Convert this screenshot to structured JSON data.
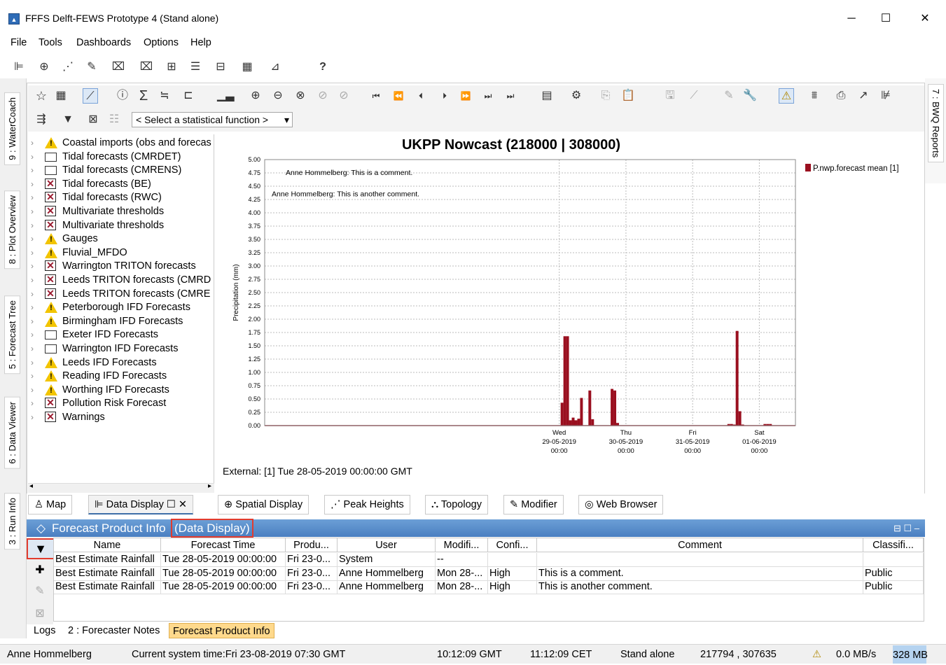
{
  "window": {
    "title": "FFFS Delft-FEWS Prototype 4  (Stand alone)",
    "minimize": "─",
    "maximize": "☐",
    "close": "✕"
  },
  "menu": [
    "File",
    "Tools",
    "Dashboards",
    "Options",
    "Help"
  ],
  "toolbar1": {
    "help": "?"
  },
  "side_tabs_left": [
    "9 : WaterCoach",
    "8 : Plot Overview",
    "5 : Forecast Tree",
    "6 : Data Viewer",
    "3 : Run Info"
  ],
  "side_tab_right": "7 : BWQ Reports",
  "stat_select": {
    "value": "< Select a statistical function >"
  },
  "tree": [
    {
      "label": "Coastal imports (obs and forecas",
      "icon": "warning-icon"
    },
    {
      "label": "Tidal forecasts (CMRDET)",
      "icon": "folder-icon"
    },
    {
      "label": "Tidal forecasts (CMRENS)",
      "icon": "folder-icon"
    },
    {
      "label": "Tidal forecasts (BE)",
      "icon": "error-icon"
    },
    {
      "label": "Tidal forecasts (RWC)",
      "icon": "error-icon"
    },
    {
      "label": "Multivariate thresholds",
      "icon": "error-icon"
    },
    {
      "label": "Multivariate thresholds",
      "icon": "error-icon"
    },
    {
      "label": "Gauges",
      "icon": "warning-icon"
    },
    {
      "label": "Fluvial_MFDO",
      "icon": "warning-icon"
    },
    {
      "label": "Warrington TRITON forecasts",
      "icon": "error-icon"
    },
    {
      "label": "Leeds TRITON forecasts (CMRD",
      "icon": "error-icon"
    },
    {
      "label": "Leeds TRITON forecasts (CMRE",
      "icon": "error-icon"
    },
    {
      "label": "Peterborough IFD Forecasts",
      "icon": "warning-icon"
    },
    {
      "label": "Birmingham IFD Forecasts",
      "icon": "warning-icon"
    },
    {
      "label": "Exeter IFD Forecasts",
      "icon": "folder-icon"
    },
    {
      "label": "Warrington IFD Forecasts",
      "icon": "folder-icon"
    },
    {
      "label": "Leeds IFD Forecasts",
      "icon": "warning-icon"
    },
    {
      "label": "Reading IFD Forecasts",
      "icon": "warning-icon"
    },
    {
      "label": "Worthing IFD Forecasts",
      "icon": "warning-icon"
    },
    {
      "label": "Pollution Risk Forecast",
      "icon": "error-icon"
    },
    {
      "label": "Warnings",
      "icon": "error-icon"
    }
  ],
  "chart_data": {
    "type": "bar",
    "title": "UKPP Nowcast (218000 | 308000)",
    "ylabel": "Precipitation (mm)",
    "ylim": [
      0,
      5
    ],
    "yticks": [
      "0.00",
      "0.25",
      "0.50",
      "0.75",
      "1.00",
      "1.25",
      "1.50",
      "1.75",
      "2.00",
      "2.25",
      "2.50",
      "2.75",
      "3.00",
      "3.25",
      "3.50",
      "3.75",
      "4.00",
      "4.25",
      "4.50",
      "4.75",
      "5.00"
    ],
    "xticks": [
      {
        "day": "Wed",
        "date": "29-05-2019",
        "time": "00:00"
      },
      {
        "day": "Thu",
        "date": "30-05-2019",
        "time": "00:00"
      },
      {
        "day": "Fri",
        "date": "31-05-2019",
        "time": "00:00"
      },
      {
        "day": "Sat",
        "date": "01-06-2019",
        "time": "00:00"
      }
    ],
    "xlim_hours": [
      -106,
      85
    ],
    "series": [
      {
        "name": "P.nwp.forecast  mean [1]",
        "color": "#9a0f1f",
        "bars": [
          [
            1,
            0.43
          ],
          [
            2,
            1.68
          ],
          [
            3,
            1.68
          ],
          [
            4,
            0.1
          ],
          [
            5,
            0.15
          ],
          [
            6,
            0.1
          ],
          [
            7,
            0.13
          ],
          [
            8,
            0.52
          ],
          [
            11,
            0.66
          ],
          [
            12,
            0.12
          ],
          [
            19,
            0.69
          ],
          [
            20,
            0.66
          ],
          [
            21,
            0.05
          ],
          [
            61,
            0.03
          ],
          [
            62,
            0.03
          ],
          [
            63,
            0.02
          ],
          [
            64,
            1.78
          ],
          [
            65,
            0.27
          ],
          [
            66,
            0.02
          ],
          [
            74,
            0.03
          ],
          [
            75,
            0.03
          ],
          [
            76,
            0.03
          ]
        ]
      }
    ],
    "annotations": [
      "Anne Hommelberg: This is a comment.",
      "Anne Hommelberg: This is another comment."
    ],
    "annotation_levels": [
      4.75,
      4.35
    ]
  },
  "external_label": "External: [1] Tue 28-05-2019 00:00:00 GMT",
  "tabs": [
    "Map",
    "Data Display",
    "Spatial Display",
    "Peak Heights",
    "Topology",
    "Modifier",
    "Web Browser"
  ],
  "fpi": {
    "title": "Forecast Product Info",
    "subtitle": "(Data Display)",
    "controls": "⊟ ☐ ‒"
  },
  "table": {
    "headers": [
      "Name",
      "Forecast Time",
      "Produ...",
      "User",
      "Modifi...",
      "Confi...",
      "Comment",
      "Classifi..."
    ],
    "rows": [
      [
        "Best Estimate Rainfall",
        "Tue 28-05-2019 00:00:00",
        "Fri 23-0...",
        "System",
        "--",
        "",
        "",
        ""
      ],
      [
        "Best Estimate Rainfall",
        "Tue 28-05-2019 00:00:00",
        "Fri 23-0...",
        "Anne Hommelberg",
        "Mon 28-...",
        "High",
        "This is a comment.",
        "Public"
      ],
      [
        "Best Estimate Rainfall",
        "Tue 28-05-2019 00:00:00",
        "Fri 23-0...",
        "Anne Hommelberg",
        "Mon 28-...",
        "High",
        "This is another comment.",
        "Public"
      ]
    ]
  },
  "bottom_tabs": [
    "Logs",
    "2 : Forecaster Notes",
    "Forecast Product Info"
  ],
  "status": {
    "user": "Anne Hommelberg",
    "system_time": "Current system time:Fri 23-08-2019 07:30 GMT",
    "gmt": "10:12:09 GMT",
    "cet": "11:12:09 CET",
    "mode": "Stand alone",
    "coords": "217794 , 307635",
    "rate": "0.0 MB/s",
    "memory": "328 MB"
  }
}
